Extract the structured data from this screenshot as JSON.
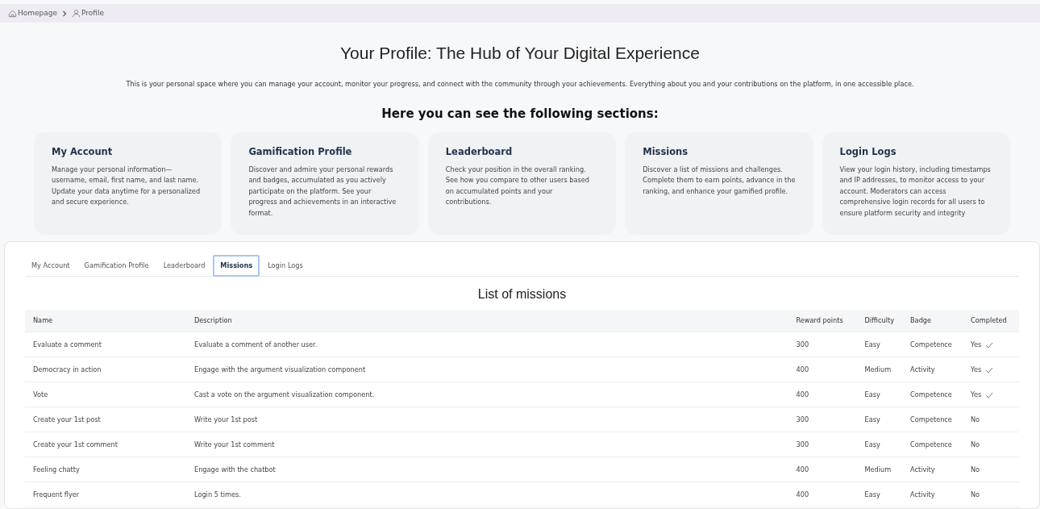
{
  "breadcrumb": [
    {
      "label": "Homepage"
    },
    {
      "label": "Profile"
    }
  ],
  "header": {
    "title": "Your Profile: The Hub of Your Digital Experience",
    "description": "This is your personal space where you can manage your account, monitor your progress, and connect with the community through your achievements. Everything about you and your contributions on the platform, in one accessible place.",
    "sections_heading": "Here you can see the following sections:"
  },
  "sections": [
    {
      "title": "My Account",
      "text": "Manage your personal information—username, email, first name, and last name. Update your data anytime for a personalized and secure experience."
    },
    {
      "title": "Gamification Profile",
      "text": "Discover and admire your personal rewards and badges, accumulated as you actively participate on the platform. See your progress and achievements in an interactive format."
    },
    {
      "title": "Leaderboard",
      "text": "Check your position in the overall ranking. See how you compare to other users based on accumulated points and your contributions."
    },
    {
      "title": "Missions",
      "text": "Discover a list of missions and challenges. Complete them to earn points, advance in the ranking, and enhance your gamified profile."
    },
    {
      "title": "Login Logs",
      "text": "View your login history, including timestamps and IP addresses, to monitor access to your account. Moderators can access comprehensive login records for all users to ensure platform security and integrity"
    }
  ],
  "tabs": [
    {
      "label": "My Account",
      "selected": false
    },
    {
      "label": "Gamification Profile",
      "selected": false
    },
    {
      "label": "Leaderboard",
      "selected": false
    },
    {
      "label": "Missions",
      "selected": true
    },
    {
      "label": "Login Logs",
      "selected": false
    }
  ],
  "table": {
    "title": "List of missions",
    "columns": [
      "Name",
      "Description",
      "Reward points",
      "Difficulty",
      "Badge",
      "Completed"
    ],
    "rows": [
      {
        "name": "Evaluate a comment",
        "description": "Evaluate a comment of another user.",
        "points": "300",
        "difficulty": "Easy",
        "badge": "Competence",
        "completed_text": "Yes",
        "completed": true
      },
      {
        "name": "Democracy in action",
        "description": "Engage with the argument visualization component",
        "points": "400",
        "difficulty": "Medium",
        "badge": "Activity",
        "completed_text": "Yes",
        "completed": true
      },
      {
        "name": "Vote",
        "description": "Cast a vote on the argument visualization component.",
        "points": "400",
        "difficulty": "Easy",
        "badge": "Competence",
        "completed_text": "Yes",
        "completed": true
      },
      {
        "name": "Create your 1st post",
        "description": "Write your 1st post",
        "points": "300",
        "difficulty": "Easy",
        "badge": "Competence",
        "completed_text": "No",
        "completed": false
      },
      {
        "name": "Create your 1st comment",
        "description": "Write your 1st comment",
        "points": "300",
        "difficulty": "Easy",
        "badge": "Competence",
        "completed_text": "No",
        "completed": false
      },
      {
        "name": "Feeling chatty",
        "description": "Engage with the chatbot",
        "points": "400",
        "difficulty": "Medium",
        "badge": "Activity",
        "completed_text": "No",
        "completed": false
      },
      {
        "name": "Frequent flyer",
        "description": "Login 5 times.",
        "points": "400",
        "difficulty": "Easy",
        "badge": "Activity",
        "completed_text": "No",
        "completed": false
      }
    ]
  }
}
